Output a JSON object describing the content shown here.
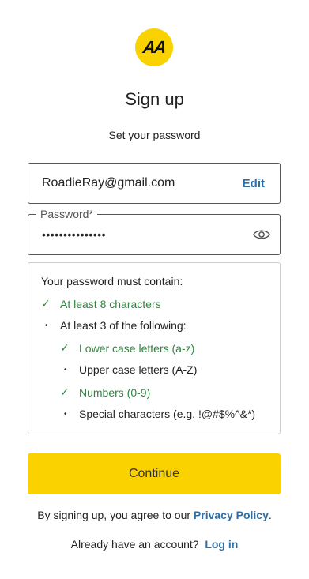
{
  "logo": {
    "text": "AA",
    "color": "#f9d200"
  },
  "header": {
    "title": "Sign up",
    "subtitle": "Set your password"
  },
  "email": {
    "value": "RoadieRay@gmail.com",
    "edit_label": "Edit"
  },
  "password": {
    "label": "Password*",
    "masked_value": "•••••••••••••••",
    "toggle_icon": "eye-icon"
  },
  "rules": {
    "heading": "Your password must contain:",
    "items": [
      {
        "text": "At least 8 characters",
        "met": true
      },
      {
        "text": "At least 3 of the following:",
        "met": false
      },
      {
        "text": "Lower case letters (a-z)",
        "met": true
      },
      {
        "text": "Upper case letters (A-Z)",
        "met": false
      },
      {
        "text": "Numbers (0-9)",
        "met": true
      },
      {
        "text": "Special characters (e.g. !@#$%^&*)",
        "met": false
      }
    ]
  },
  "actions": {
    "continue_label": "Continue"
  },
  "footer": {
    "terms_prefix": "By signing up, you agree to our",
    "privacy_label": "Privacy Policy",
    "terms_suffix": ".",
    "login_prefix": "Already have an account?",
    "login_label": "Log in"
  },
  "colors": {
    "accent": "#f9d200",
    "link": "#2f6ea4",
    "success": "#2e8540"
  }
}
